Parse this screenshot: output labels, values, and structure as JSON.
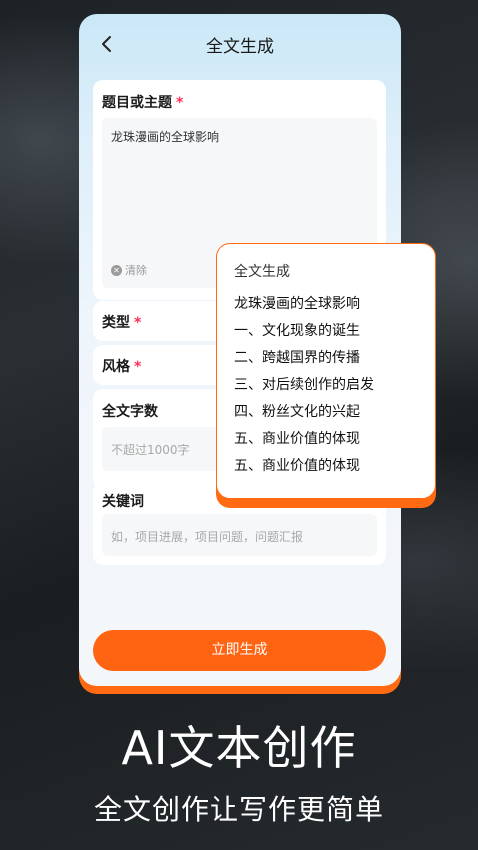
{
  "nav": {
    "title": "全文生成",
    "back_icon": "chevron-left-icon"
  },
  "form": {
    "topic": {
      "label": "题目或主题",
      "required_mark": "*",
      "value": "龙珠漫画的全球影响",
      "clear_label": "清除",
      "clear_icon": "clear-circle-icon"
    },
    "type": {
      "label": "类型",
      "required_mark": "*"
    },
    "style": {
      "label": "风格",
      "required_mark": "*"
    },
    "word_count": {
      "label": "全文字数",
      "placeholder": "不超过1000字"
    },
    "keywords": {
      "label": "关键词",
      "placeholder": "如，项目进展，项目问题，问题汇报"
    },
    "generate_button": "立即生成"
  },
  "popup": {
    "title": "全文生成",
    "items": [
      "龙珠漫画的全球影响",
      "一、文化现象的诞生",
      "二、跨越国界的传播",
      "三、对后续创作的启发",
      "四、粉丝文化的兴起",
      "五、商业价值的体现",
      "五、商业价值的体现"
    ]
  },
  "promo": {
    "headline": "AI文本创作",
    "subline": "全文创作让写作更简单"
  },
  "colors": {
    "accent": "#ff6413",
    "required": "#ff2d55",
    "background": "#1f2427"
  }
}
